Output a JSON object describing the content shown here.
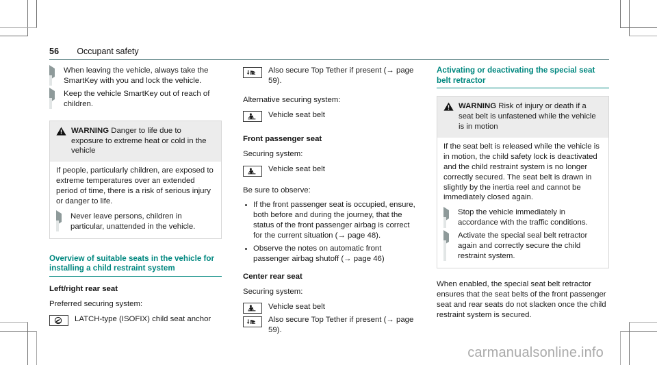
{
  "header": {
    "page_number": "56",
    "title": "Occupant safety"
  },
  "column1": {
    "actions_top": [
      "When leaving the vehicle, always take the SmartKey with you and lock the vehicle.",
      "Keep the vehicle SmartKey out of reach of children."
    ],
    "warning": {
      "icon": "warning-triangle-icon",
      "label": "WARNING",
      "headline": "Danger to life due to exposure to extreme heat or cold in the vehicle",
      "body": "If people, particularly children, are exposed to extreme temperatures over an extended period of time, there is a risk of serious injury or danger to life.",
      "actions": [
        "Never leave persons, children in particular, unattended in the vehicle."
      ]
    },
    "overview_heading": "Overview of suitable seats in the vehicle for installing a child restraint system",
    "subheading": "Left/right rear seat",
    "preferred_label": "Preferred securing system:",
    "preferred_items": [
      {
        "icon": "isofix-anchor-icon",
        "text": "LATCH-type (ISOFIX) child seat anchor"
      }
    ]
  },
  "column2": {
    "top_items": [
      {
        "icon": "top-tether-icon",
        "text": "Also secure Top Tether if present (→ page 59)."
      }
    ],
    "alternative_label": "Alternative securing system:",
    "alternative_items": [
      {
        "icon": "seat-belt-icon",
        "text": "Vehicle seat belt"
      }
    ],
    "front_passenger_heading": "Front passenger seat",
    "front_securing_label": "Securing system:",
    "front_securing_items": [
      {
        "icon": "seat-belt-icon",
        "text": "Vehicle seat belt"
      }
    ],
    "observe_label": "Be sure to observe:",
    "observe_bullets": [
      "If the front passenger seat is occupied, ensure, both before and during the journey, that the status of the front passenger airbag is correct for the current situation (→ page 48).",
      "Observe the notes on automatic front passenger airbag shutoff (→ page 46)"
    ],
    "center_rear_heading": "Center rear seat",
    "center_securing_label": "Securing system:",
    "center_securing_items": [
      {
        "icon": "seat-belt-icon",
        "text": "Vehicle seat belt"
      },
      {
        "icon": "top-tether-icon",
        "text": "Also secure Top Tether if present (→ page 59)."
      }
    ]
  },
  "column3": {
    "heading": "Activating or deactivating the special seat belt retractor",
    "warning": {
      "icon": "warning-triangle-icon",
      "label": "WARNING",
      "headline": "Risk of injury or death if a seat belt is unfastened while the vehicle is in motion",
      "body": "If the seat belt is released while the vehicle is in motion, the child safety lock is deactivated and the child restraint system is no longer correctly secured. The seat belt is drawn in slightly by the inertia reel and cannot be immediately closed again.",
      "actions": [
        "Stop the vehicle immediately in accordance with the traffic conditions.",
        "Activate the special seal belt retractor again and correctly secure the child restraint system."
      ]
    },
    "closing_paragraph": "When enabled, the special seat belt retractor ensures that the seat belts of the front passenger seat and rear seats do not slacken once the child restraint system is secured."
  },
  "watermark": "carmanualsonline.info",
  "colors": {
    "accent_teal": "#00877f",
    "header_rule": "#2f5f62",
    "warning_header_bg": "#ececec",
    "arrow_bullet": "#8e9a9a",
    "watermark": "#a9a9a9"
  }
}
